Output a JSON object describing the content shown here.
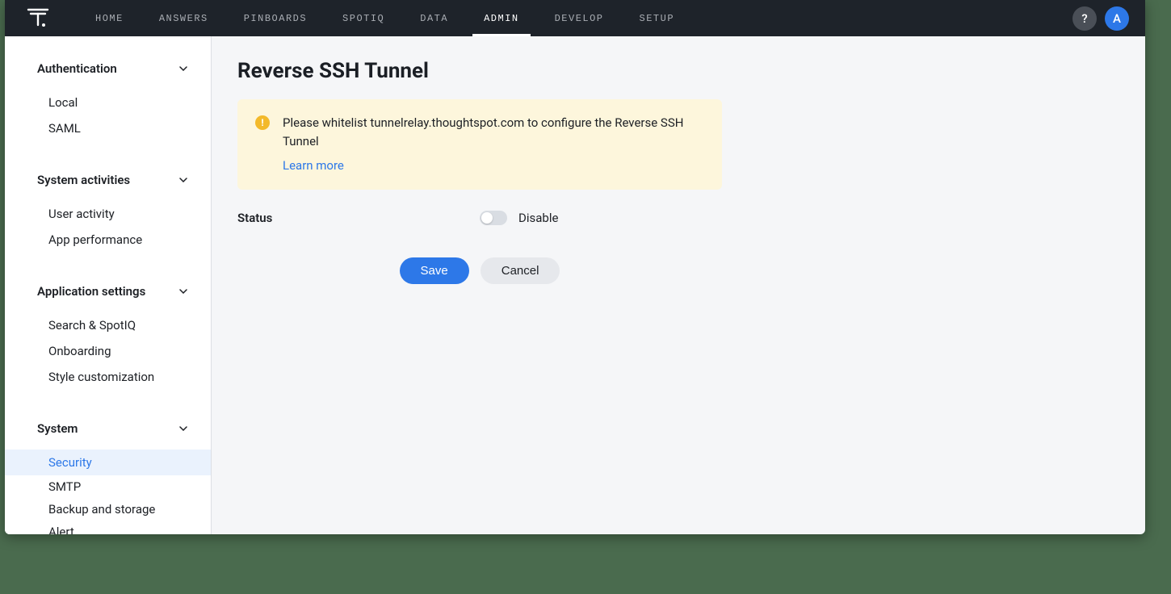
{
  "topnav": {
    "items": [
      {
        "label": "HOME"
      },
      {
        "label": "ANSWERS"
      },
      {
        "label": "PINBOARDS"
      },
      {
        "label": "SPOTIQ"
      },
      {
        "label": "DATA"
      },
      {
        "label": "ADMIN",
        "active": true
      },
      {
        "label": "DEVELOP"
      },
      {
        "label": "SETUP"
      }
    ],
    "help_label": "?",
    "avatar_letter": "A"
  },
  "sidebar": {
    "sections": [
      {
        "title": "Authentication",
        "items": [
          {
            "label": "Local"
          },
          {
            "label": "SAML"
          }
        ]
      },
      {
        "title": "System activities",
        "items": [
          {
            "label": "User activity"
          },
          {
            "label": "App performance"
          }
        ]
      },
      {
        "title": "Application settings",
        "items": [
          {
            "label": "Search & SpotIQ"
          },
          {
            "label": "Onboarding"
          },
          {
            "label": "Style customization"
          }
        ]
      },
      {
        "title": "System",
        "items": [
          {
            "label": "Security",
            "active": true
          },
          {
            "label": "SMTP"
          },
          {
            "label": "Backup and storage"
          },
          {
            "label": "Alert"
          }
        ]
      }
    ]
  },
  "main": {
    "title": "Reverse SSH Tunnel",
    "notice_text": "Please whitelist tunnelrelay.thoughtspot.com to configure the Reverse SSH Tunnel",
    "notice_link": "Learn more",
    "status_label": "Status",
    "status_value": "Disable",
    "save_label": "Save",
    "cancel_label": "Cancel"
  }
}
